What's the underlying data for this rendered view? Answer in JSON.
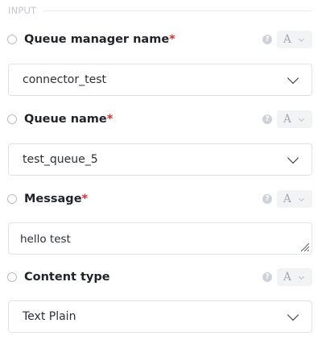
{
  "section": {
    "title": "INPUT"
  },
  "fields": [
    {
      "label": "Queue manager name",
      "required": "*",
      "help": "?",
      "type_letter": "A",
      "value": "connector_test"
    },
    {
      "label": "Queue name",
      "required": "*",
      "help": "?",
      "type_letter": "A",
      "value": "test_queue_5"
    },
    {
      "label": "Message",
      "required": "*",
      "help": "?",
      "type_letter": "A",
      "value": "hello test"
    },
    {
      "label": "Content type",
      "required": "",
      "help": "?",
      "type_letter": "A",
      "value": "Text Plain"
    }
  ],
  "icons": {
    "help": "question-circle-icon",
    "type": "text-type-icon",
    "dropdown": "chevron-down-icon",
    "resize": "resize-handle-icon"
  },
  "colors": {
    "required": "#d63031",
    "section_title": "#c2c7cf",
    "border": "#dfe3e8"
  }
}
